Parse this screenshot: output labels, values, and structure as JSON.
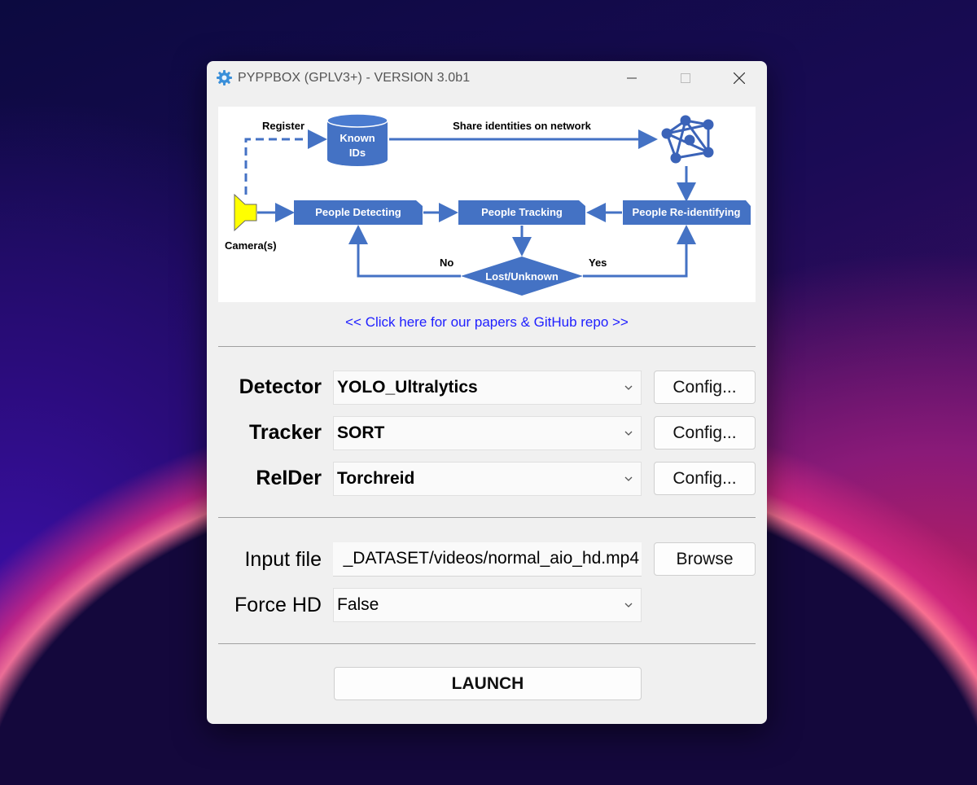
{
  "window": {
    "title": "PYPPBOX (GPLV3+) - VERSION 3.0b1"
  },
  "diagram": {
    "register": "Register",
    "known_ids_line1": "Known",
    "known_ids_line2": "IDs",
    "share": "Share identities on network",
    "camera": "Camera(s)",
    "detecting": "People Detecting",
    "tracking": "People Tracking",
    "reidentifying": "People Re-identifying",
    "lost": "Lost/Unknown",
    "no": "No",
    "yes": "Yes",
    "colors": {
      "box": "#4472c4",
      "camera": "#ffff00",
      "network": "#3b63b8"
    }
  },
  "link_text": "<< Click here for our papers & GitHub repo >>",
  "rows": {
    "detector": {
      "label": "Detector",
      "value": "YOLO_Ultralytics",
      "button": "Config..."
    },
    "tracker": {
      "label": "Tracker",
      "value": "SORT",
      "button": "Config..."
    },
    "reider": {
      "label": "ReIDer",
      "value": "Torchreid",
      "button": "Config..."
    }
  },
  "input_file": {
    "label": "Input file",
    "value": "_DATASET/videos/normal_aio_hd.mp4",
    "button": "Browse"
  },
  "force_hd": {
    "label": "Force HD",
    "value": "False"
  },
  "launch_label": "LAUNCH"
}
